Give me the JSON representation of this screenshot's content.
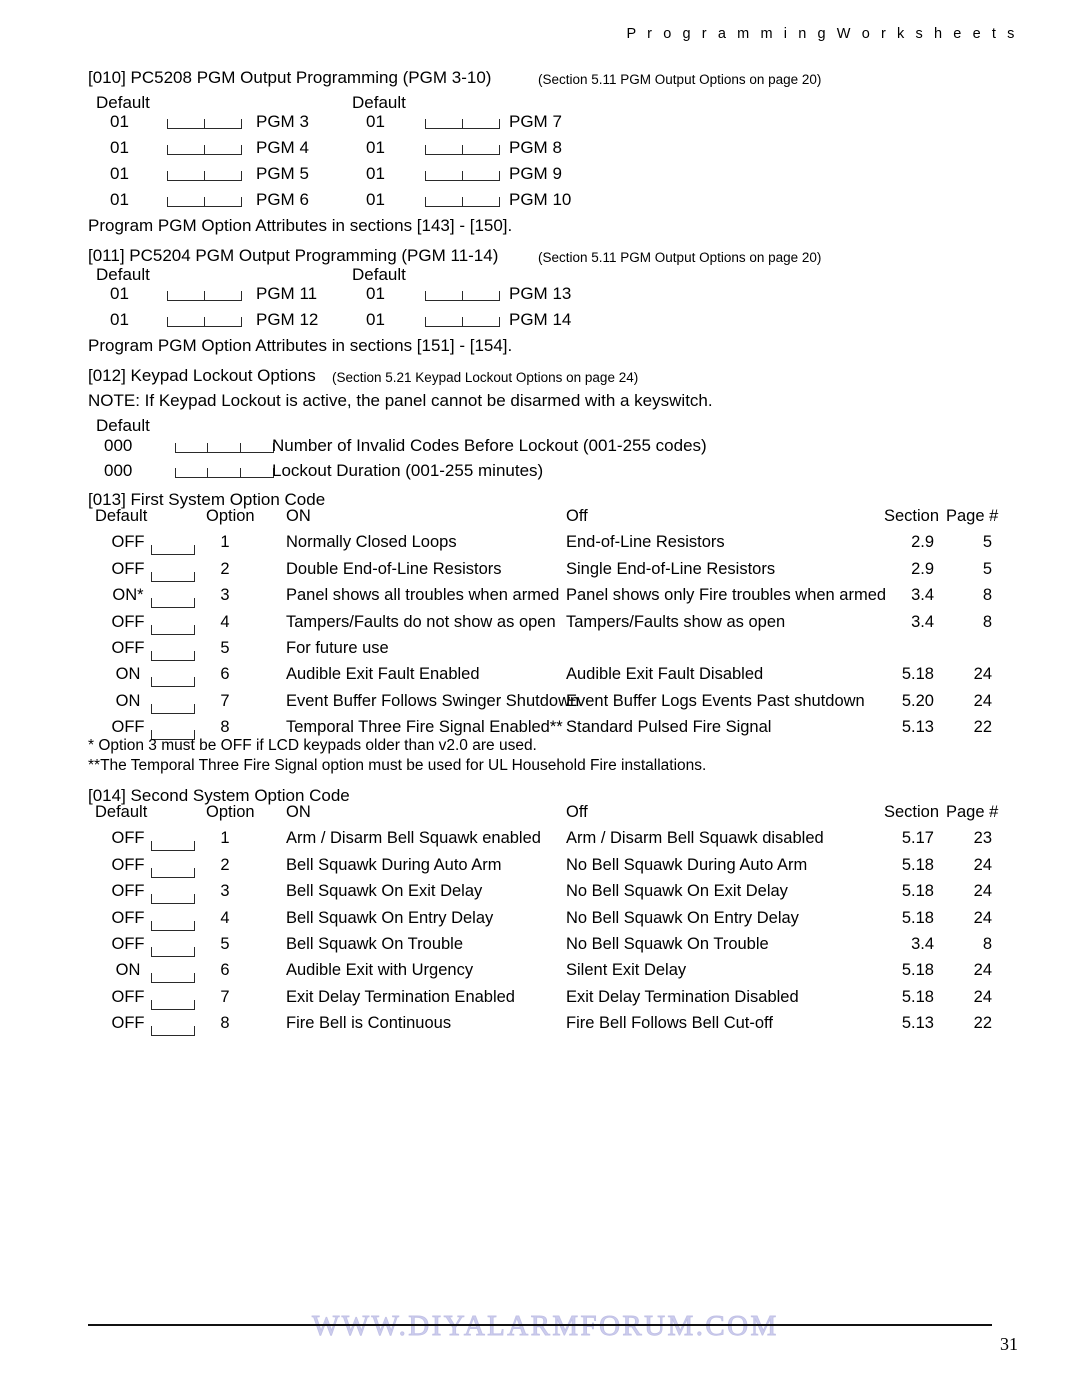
{
  "header": {
    "running_title": "P r o g r a m m i n g   W o r k s h e e t s"
  },
  "sections": {
    "s010": {
      "title": "[010] PC5208 PGM Output Programming (PGM 3-10)",
      "reference": "(Section 5.11  PGM Output Options   on page 20)",
      "default_label_left": "Default",
      "default_label_right": "Default",
      "rows": [
        {
          "left_default": "01",
          "left_label": "PGM 3",
          "right_default": "01",
          "right_label": "PGM 7"
        },
        {
          "left_default": "01",
          "left_label": "PGM 4",
          "right_default": "01",
          "right_label": "PGM 8"
        },
        {
          "left_default": "01",
          "left_label": "PGM 5",
          "right_default": "01",
          "right_label": "PGM 9"
        },
        {
          "left_default": "01",
          "left_label": "PGM 6",
          "right_default": "01",
          "right_label": "PGM 10"
        }
      ],
      "footnote": "Program PGM Option Attributes in sections [143] - [150]."
    },
    "s011": {
      "title": "[011] PC5204 PGM Output Programming (PGM 11-14)",
      "reference": "(Section 5.11  PGM Output Options   on page 20)",
      "default_label_left": "Default",
      "default_label_right": "Default",
      "rows": [
        {
          "left_default": "01",
          "left_label": "PGM 11",
          "right_default": "01",
          "right_label": "PGM 13"
        },
        {
          "left_default": "01",
          "left_label": "PGM 12",
          "right_default": "01",
          "right_label": "PGM 14"
        }
      ],
      "footnote": "Program PGM Option Attributes in sections [151] - [154]."
    },
    "s012": {
      "title": "[012] Keypad Lockout Options",
      "reference": "(Section 5.21  Keypad Lockout Options   on page 24)",
      "note": "NOTE: If Keypad Lockout is active, the panel cannot be disarmed with a keyswitch.",
      "default_label": "Default",
      "rows": [
        {
          "default": "000",
          "label": "Number of Invalid Codes Before Lockout (001-255 codes)"
        },
        {
          "default": "000",
          "label": "Lockout Duration (001-255 minutes)"
        }
      ]
    },
    "s013": {
      "title": "[013] First System Option Code",
      "columns": {
        "default": "Default",
        "option": "Option",
        "on": "ON",
        "off": "Off",
        "section": "Section",
        "page": "Page #"
      },
      "rows": [
        {
          "default": "OFF",
          "option": "1",
          "on": "Normally Closed Loops",
          "off": "End-of-Line Resistors",
          "section": "2.9",
          "page": "5"
        },
        {
          "default": "OFF",
          "option": "2",
          "on": "Double End-of-Line Resistors",
          "off": "Single End-of-Line Resistors",
          "section": "2.9",
          "page": "5"
        },
        {
          "default": "ON*",
          "option": "3",
          "on": "Panel shows all troubles when armed",
          "off": "Panel shows only Fire troubles when armed",
          "section": "3.4",
          "page": "8"
        },
        {
          "default": "OFF",
          "option": "4",
          "on": "Tampers/Faults do not show as open",
          "off": "Tampers/Faults show as open",
          "section": "3.4",
          "page": "8"
        },
        {
          "default": "OFF",
          "option": "5",
          "on": "For future use",
          "off": "",
          "section": "",
          "page": ""
        },
        {
          "default": "ON",
          "option": "6",
          "on": "Audible Exit Fault Enabled",
          "off": "Audible Exit Fault Disabled",
          "section": "5.18",
          "page": "24"
        },
        {
          "default": "ON",
          "option": "7",
          "on": "Event Buffer Follows Swinger Shutdown",
          "off": "Event Buffer Logs Events Past shutdown",
          "section": "5.20",
          "page": "24"
        },
        {
          "default": "OFF",
          "option": "8",
          "on": "Temporal Three Fire Signal Enabled**",
          "off": "Standard Pulsed Fire Signal",
          "section": "5.13",
          "page": "22"
        }
      ],
      "footnote1": "* Option 3 must be OFF if LCD keypads older than v2.0 are used.",
      "footnote2": "**The Temporal Three Fire Signal option must be used for UL Household Fire installations."
    },
    "s014": {
      "title": "[014] Second System Option Code",
      "columns": {
        "default": "Default",
        "option": "Option",
        "on": "ON",
        "off": "Off",
        "section": "Section",
        "page": "Page #"
      },
      "rows": [
        {
          "default": "OFF",
          "option": "1",
          "on": "Arm / Disarm Bell Squawk enabled",
          "off": "Arm / Disarm Bell Squawk disabled",
          "section": "5.17",
          "page": "23"
        },
        {
          "default": "OFF",
          "option": "2",
          "on": "Bell Squawk During Auto Arm",
          "off": "No Bell Squawk During Auto Arm",
          "section": "5.18",
          "page": "24"
        },
        {
          "default": "OFF",
          "option": "3",
          "on": "Bell Squawk On Exit Delay",
          "off": "No Bell Squawk On Exit Delay",
          "section": "5.18",
          "page": "24"
        },
        {
          "default": "OFF",
          "option": "4",
          "on": "Bell Squawk On Entry Delay",
          "off": "No Bell Squawk On Entry Delay",
          "section": "5.18",
          "page": "24"
        },
        {
          "default": "OFF",
          "option": "5",
          "on": "Bell Squawk On Trouble",
          "off": "No Bell Squawk On Trouble",
          "section": "3.4",
          "page": "8"
        },
        {
          "default": "ON",
          "option": "6",
          "on": "Audible Exit with Urgency",
          "off": "Silent Exit Delay",
          "section": "5.18",
          "page": "24"
        },
        {
          "default": "OFF",
          "option": "7",
          "on": "Exit Delay Termination Enabled",
          "off": "Exit Delay Termination Disabled",
          "section": "5.18",
          "page": "24"
        },
        {
          "default": "OFF",
          "option": "8",
          "on": "Fire Bell is Continuous",
          "off": "Fire Bell Follows Bell Cut-off",
          "section": "5.13",
          "page": "22"
        }
      ]
    }
  },
  "footer": {
    "watermark": "WWW.DIYALARMFORUM.COM",
    "page_number": "31"
  }
}
